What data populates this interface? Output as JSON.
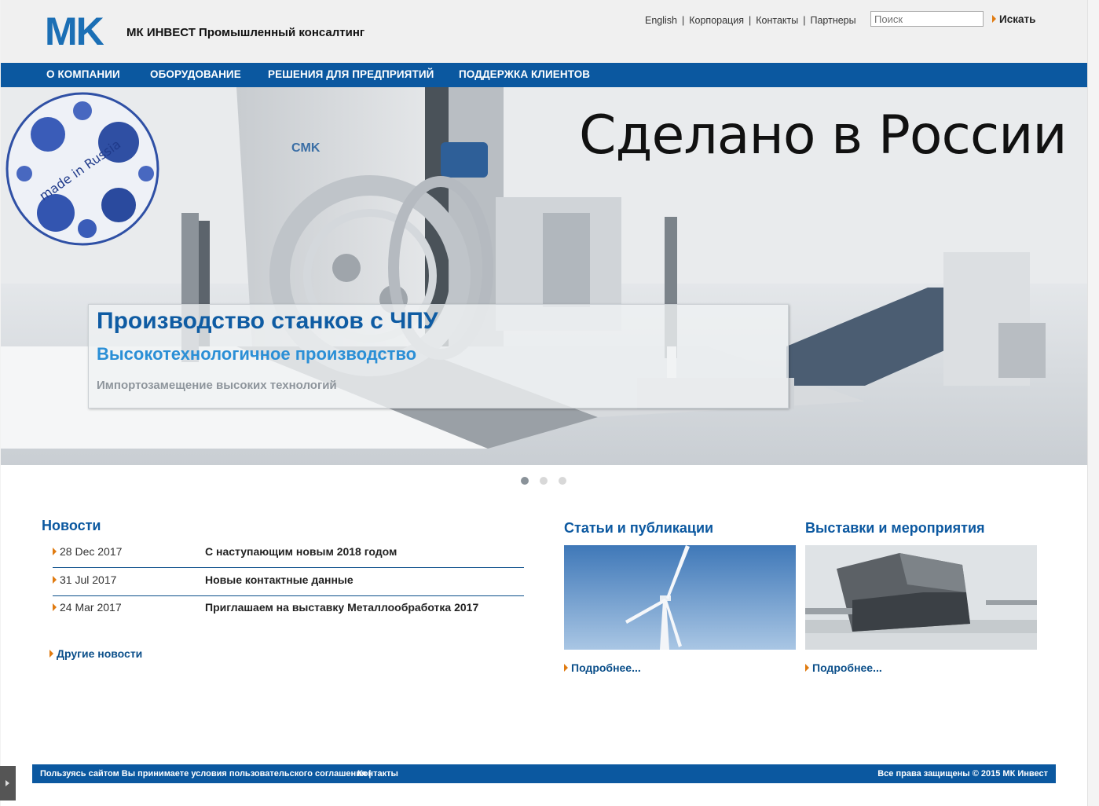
{
  "header": {
    "logo": "MK",
    "company": "МК ИНВЕСТ Промышленный консалтинг",
    "links": [
      "English",
      "Корпорация",
      "Контакты",
      "Партнеры"
    ],
    "search_placeholder": "Поиск",
    "search_button": "Искать"
  },
  "nav": {
    "items": [
      "О КОМПАНИИ",
      "ОБОРУДОВАНИЕ",
      "РЕШЕНИЯ ДЛЯ ПРЕДПРИЯТИЙ",
      "ПОДДЕРЖКА КЛИЕНТОВ"
    ]
  },
  "hero": {
    "title": "Сделано в России",
    "badge": "made in Russia",
    "machine_logo": "CMK",
    "caption_title": "Производство станков с ЧПУ",
    "caption_subtitle": "Высокотехнологичное производство",
    "caption_text": "Импортозамещение высоких технологий",
    "slides": 3,
    "active_slide": 1
  },
  "news": {
    "title": "Новости",
    "items": [
      {
        "date": "28 Dec 2017",
        "title": "С наступающим новым 2018 годом"
      },
      {
        "date": "31 Jul 2017",
        "title": "Новые контактные данные"
      },
      {
        "date": "24 Mar 2017",
        "title": "Приглашаем на выставку Металлообработка 2017"
      }
    ],
    "more": "Другие новости"
  },
  "articles": {
    "title": "Статьи и публикации",
    "more": "Подробнее..."
  },
  "events": {
    "title": "Выставки и мероприятия",
    "more": "Подробнее..."
  },
  "footer": {
    "agreement": "Пользуясь сайтом Вы принимаете условия пользовательского соглашения |",
    "contacts": "Контакты",
    "copyright": "Все права защищены © 2015 МК Инвест"
  },
  "colors": {
    "brand_blue": "#0b58a0",
    "accent_orange": "#e07b10",
    "logo_blue": "#1b6fb5"
  }
}
